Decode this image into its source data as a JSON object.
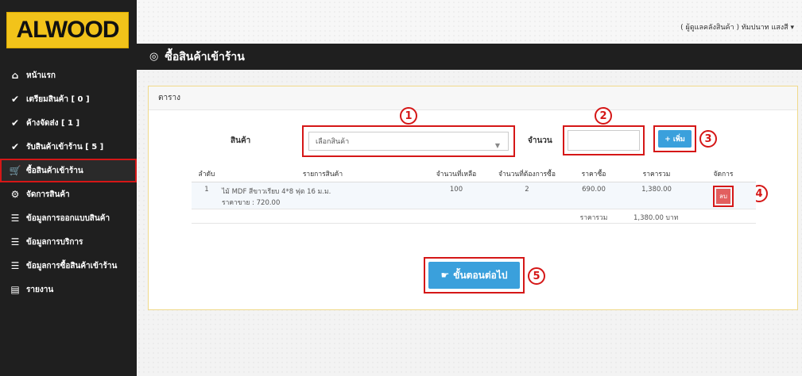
{
  "logo": {
    "text_a": "AL",
    "text_b": "WOOD"
  },
  "user_menu": {
    "label": "( ผู้ดูแลคลังสินค้า ) ทัมปนาท แสงสี ▾"
  },
  "header": {
    "title": "ซื้อสินค้าเข้าร้าน"
  },
  "sidebar": {
    "items": [
      {
        "label": "หน้าแรก"
      },
      {
        "label": "เตรียมสินค้า [ 0 ]"
      },
      {
        "label": "ค้างจัดส่ง [ 1 ]"
      },
      {
        "label": "รับสินค้าเข้าร้าน [ 5 ]"
      },
      {
        "label": "ซื้อสินค้าเข้าร้าน"
      },
      {
        "label": "จัดการสินค้า"
      },
      {
        "label": "ข้อมูลการออกแบบสินค้า"
      },
      {
        "label": "ข้อมูลการบริการ"
      },
      {
        "label": "ข้อมูลการซื้อสินค้าเข้าร้าน"
      },
      {
        "label": "รายงาน"
      }
    ]
  },
  "panel": {
    "title": "ตาราง"
  },
  "form": {
    "product_label": "สินค้า",
    "product_select": "เลือกสินค้า",
    "qty_label": "จำนวน",
    "qty_value": "",
    "add_button": "+ เพิ่ม"
  },
  "markers": [
    "1",
    "2",
    "3",
    "4",
    "5"
  ],
  "table": {
    "headers": [
      "ลำดับ",
      "รายการสินค้า",
      "จำนวนที่เหลือ",
      "จำนวนที่ต้องการซื้อ",
      "ราคาซื้อ",
      "ราคารวม",
      "จัดการ"
    ],
    "rows": [
      {
        "no": "1",
        "item": "ไม้ MDF สีขาวเรียบ 4*8 ฟุต 16 ม.ม.",
        "sub": "ราคาขาย : 720.00",
        "remaining": "100",
        "buy_qty": "2",
        "price": "690.00",
        "total": "1,380.00",
        "delete_label": "ลบ"
      }
    ],
    "sum_label": "ราคารวม",
    "sum_value": "1,380.00 บาท"
  },
  "next_button": "ขั้นตอนต่อไป"
}
